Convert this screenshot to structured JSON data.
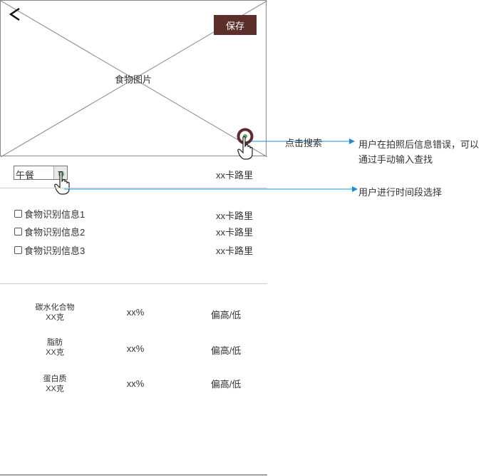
{
  "header": {
    "back_icon": "chevron-left-icon",
    "save_label": "保存",
    "save_color": "#5c2e2a",
    "photo_label": "食物图片",
    "search_icon": "search-icon"
  },
  "meal": {
    "selected": "午餐",
    "total_calories": "xx卡路里"
  },
  "food_items": [
    {
      "label": "食物识别信息1",
      "calories": "xx卡路里"
    },
    {
      "label": "食物识别信息2",
      "calories": "xx卡路里"
    },
    {
      "label": "食物识别信息3",
      "calories": "xx卡路里"
    }
  ],
  "nutrients": [
    {
      "name": "碳水化合物",
      "amount": "XX克",
      "percent": "xx%",
      "level": "偏高/低"
    },
    {
      "name": "脂肪",
      "amount": "XX克",
      "percent": "xx%",
      "level": "偏高/低"
    },
    {
      "name": "蛋白质",
      "amount": "XX克",
      "percent": "xx%",
      "level": "偏高/低"
    }
  ],
  "annotations": {
    "search_action": "点击搜索",
    "search_desc_line1": "用户在拍照后信息错误，可以",
    "search_desc_line2": "通过手动输入查找",
    "meal_desc": "用户进行时间段选择",
    "arrow_color": "#1a8fd8"
  }
}
